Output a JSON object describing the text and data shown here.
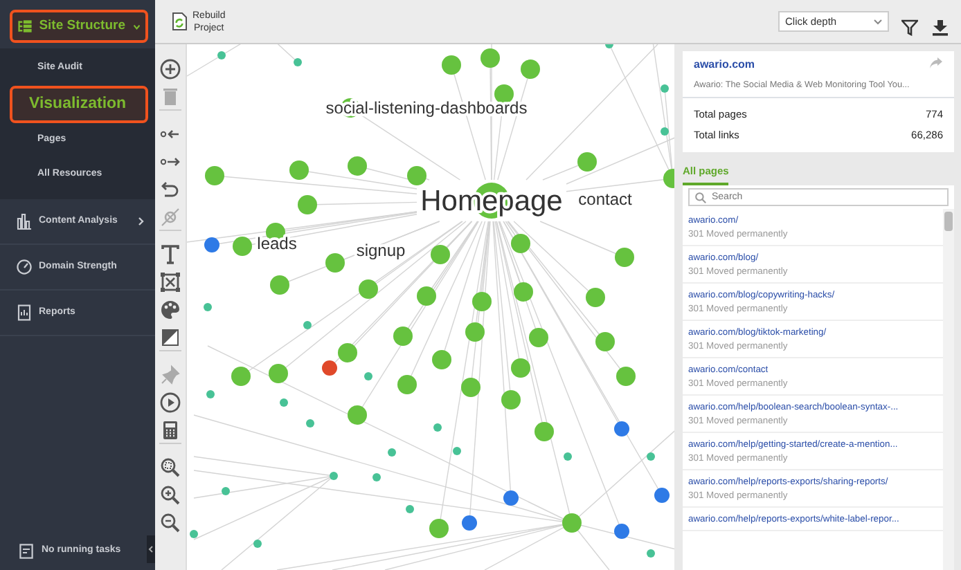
{
  "sidebar": {
    "section": {
      "label": "Site Structure",
      "expanded": true,
      "highlighted": true
    },
    "subitems": [
      {
        "label": "Site Audit",
        "selected": false
      },
      {
        "label": "Visualization",
        "selected": true
      },
      {
        "label": "Pages",
        "selected": false
      },
      {
        "label": "All Resources",
        "selected": false
      }
    ],
    "items": [
      {
        "label": "Content Analysis",
        "kind": "chart",
        "has_submenu": true
      },
      {
        "label": "Domain Strength",
        "kind": "gauge",
        "has_submenu": false
      },
      {
        "label": "Reports",
        "kind": "report",
        "has_submenu": false
      }
    ],
    "status": "No running tasks"
  },
  "toolbar": {
    "rebuild": "Rebuild\nProject",
    "dropdown": "Click depth"
  },
  "tool_groups": [
    [
      {
        "kind": "add",
        "disabled": false
      },
      {
        "kind": "delete",
        "disabled": true
      }
    ],
    [
      {
        "kind": "in",
        "disabled": false
      },
      {
        "kind": "out",
        "disabled": false
      },
      {
        "kind": "undo",
        "disabled": false
      },
      {
        "kind": "unlink",
        "disabled": true
      }
    ],
    [
      {
        "kind": "text",
        "disabled": false
      },
      {
        "kind": "frame",
        "disabled": false
      },
      {
        "kind": "palette",
        "disabled": false
      },
      {
        "kind": "contrast",
        "disabled": false
      }
    ],
    [
      {
        "kind": "pin",
        "disabled": true
      },
      {
        "kind": "play",
        "disabled": false
      },
      {
        "kind": "calc",
        "disabled": false
      }
    ],
    [
      {
        "kind": "zoomfit",
        "disabled": false
      },
      {
        "kind": "zoomin",
        "disabled": false
      },
      {
        "kind": "zoomout",
        "disabled": false
      }
    ]
  ],
  "graph": {
    "labels": [
      {
        "text": "social-listening-dashboards",
        "kind": "small"
      },
      {
        "text": "Homepage",
        "kind": "hub"
      },
      {
        "text": "contact",
        "kind": "small"
      },
      {
        "text": "leads",
        "kind": "small"
      },
      {
        "text": "signup",
        "kind": "small"
      }
    ]
  },
  "site_card": {
    "domain": "awario.com",
    "description": "Awario: The Social Media & Web Monitoring Tool You...",
    "stats": [
      {
        "label": "Total pages",
        "value": "774"
      },
      {
        "label": "Total links",
        "value": "66,286"
      }
    ]
  },
  "tabs": [
    {
      "label": "All pages",
      "selected": true
    }
  ],
  "search": {
    "placeholder": "Search"
  },
  "pages": [
    {
      "url": "awario.com/",
      "status": "301 Moved permanently"
    },
    {
      "url": "awario.com/blog/",
      "status": "301 Moved permanently"
    },
    {
      "url": "awario.com/blog/copywriting-hacks/",
      "status": "301 Moved permanently"
    },
    {
      "url": "awario.com/blog/tiktok-marketing/",
      "status": "301 Moved permanently"
    },
    {
      "url": "awario.com/contact",
      "status": "301 Moved permanently"
    },
    {
      "url": "awario.com/help/boolean-search/boolean-syntax-...",
      "status": "301 Moved permanently"
    },
    {
      "url": "awario.com/help/getting-started/create-a-mention...",
      "status": "301 Moved permanently"
    },
    {
      "url": "awario.com/help/reports-exports/sharing-reports/",
      "status": "301 Moved permanently"
    },
    {
      "url": "awario.com/help/reports-exports/white-label-repor..."
    }
  ]
}
